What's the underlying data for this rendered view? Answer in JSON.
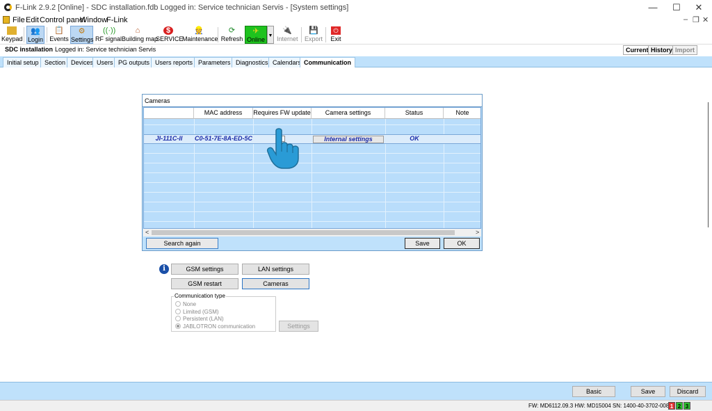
{
  "window": {
    "title": "F-Link 2.9.2 [Online] - SDC installation.fdb Logged in: Service technician Servis - [System settings]",
    "minimize": "—",
    "maximize": "☐",
    "close": "✕"
  },
  "menu": {
    "items": [
      "File",
      "Edit",
      "Control panel",
      "Window",
      "F-Link"
    ]
  },
  "toolbar": {
    "keypad": "Keypad",
    "login": "Login",
    "events": "Events",
    "settings": "Settings",
    "rf_signal": "RF signal",
    "building_map": "Building map",
    "service": "SERVICE",
    "maintenance": "Maintenance",
    "refresh": "Refresh",
    "online": "Online",
    "internet": "Internet",
    "export": "Export",
    "exit": "Exit"
  },
  "install": {
    "name": "SDC installation",
    "logged": "Logged in: Service technician Servis"
  },
  "right_tabs": {
    "current": "Current",
    "history": "History",
    "import": "Import"
  },
  "tabs": [
    "Initial setup",
    "Section",
    "Devices",
    "Users",
    "PG outputs",
    "Users reports",
    "Parameters",
    "Diagnostics",
    "Calendars",
    "Communication"
  ],
  "cameras": {
    "title": "Cameras",
    "columns": {
      "mac": "MAC address",
      "fw": "Requires FW update",
      "settings": "Camera settings",
      "status": "Status",
      "note": "Note"
    },
    "row": {
      "name": "JI-111C-II",
      "mac": "C0-51-7E-8A-ED-5C",
      "settings_btn": "Internal settings",
      "status": "OK",
      "note": ""
    },
    "search_again": "Search again",
    "save": "Save",
    "ok": "OK"
  },
  "comm": {
    "info": "i",
    "gsm_settings": "GSM settings",
    "lan_settings": "LAN settings",
    "gsm_restart": "GSM restart",
    "cameras": "Cameras",
    "group_title": "Communication type",
    "options": [
      "None",
      "Limited (GSM)",
      "Persistent (LAN)",
      "JABLOTRON communication"
    ],
    "settings": "Settings"
  },
  "footer": {
    "basic": "Basic",
    "save": "Save",
    "discard": "Discard"
  },
  "status": {
    "text": "FW: MD6112.09.3 HW: MD15004 SN: 1400-40-3702-0086",
    "b1": "1",
    "b2": "2",
    "b3": "3"
  }
}
